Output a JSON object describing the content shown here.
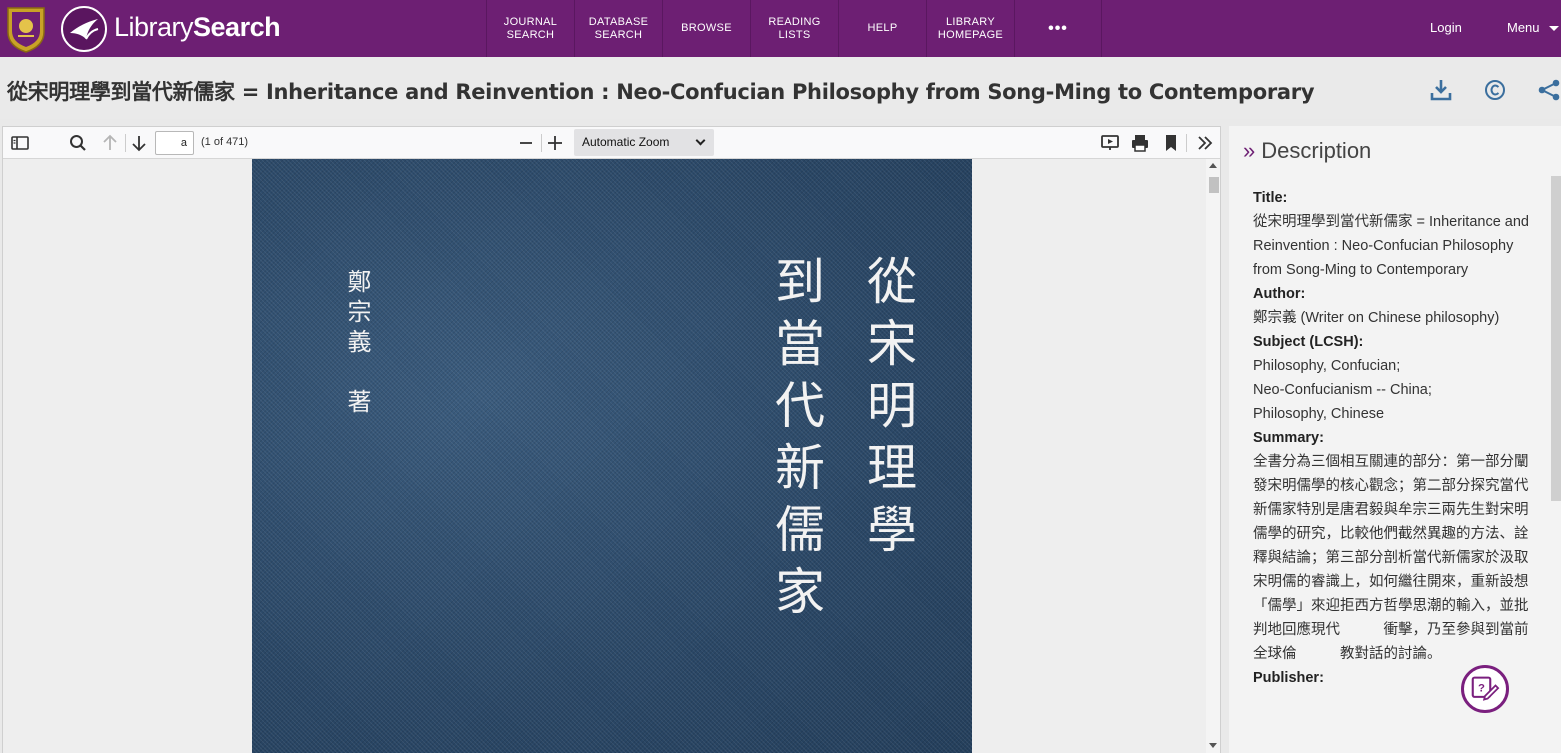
{
  "brand": {
    "library": "Library",
    "search": "Search"
  },
  "nav": {
    "items": [
      {
        "label": "JOURNAL\nSEARCH",
        "width": 88
      },
      {
        "label": "DATABASE\nSEARCH",
        "width": 88
      },
      {
        "label": "BROWSE",
        "width": 88
      },
      {
        "label": "READING LISTS",
        "width": 88
      },
      {
        "label": "HELP",
        "width": 88
      },
      {
        "label": "LIBRARY\nHOMEPAGE",
        "width": 88
      }
    ],
    "more_label": "•••",
    "login": "Login",
    "menu": "Menu"
  },
  "title": "從宋明理學到當代新儒家 = Inheritance and Reinvention : Neo-Confucian Philosophy from Song-Ming to Contemporary",
  "viewer": {
    "page_value": "a",
    "page_count": "(1 of 471)",
    "zoom": "Automatic Zoom"
  },
  "cover": {
    "title_line1": "從宋明理學",
    "title_line2": "到當代新儒家",
    "author": "鄭宗義　著"
  },
  "description": {
    "heading": "Description",
    "title_label": "Title:",
    "title_value": "從宋明理學到當代新儒家 = Inheritance and Reinvention : Neo-Confucian Philosophy from Song-Ming to Contemporary",
    "author_label": "Author:",
    "author_value": "鄭宗義 (Writer on Chinese philosophy)",
    "subject_label": "Subject (LCSH):",
    "subjects": [
      "Philosophy, Confucian;",
      "Neo-Confucianism -- China;",
      "Philosophy, Chinese"
    ],
    "summary_label": "Summary:",
    "summary_value": "全書分為三個相互關連的部分：第一部分闡發宋明儒學的核心觀念；第二部分探究當代新儒家特別是唐君毅與牟宗三兩先生對宋明儒學的研究，比較他們截然異趣的方法、詮釋與結論；第三部分剖析當代新儒家於汲取宋明儒的睿識上，如何繼往開來，重新設想「儒學」來迎拒西方哲學思潮的輸入，並批判地回應現代　　　衝擊，乃至參與到當前全球倫　　　教對話的討論。",
    "next_label": "Publisher:"
  },
  "colors": {
    "brand_purple": "#6d1f73",
    "icon_blue": "#3b6f9e"
  }
}
